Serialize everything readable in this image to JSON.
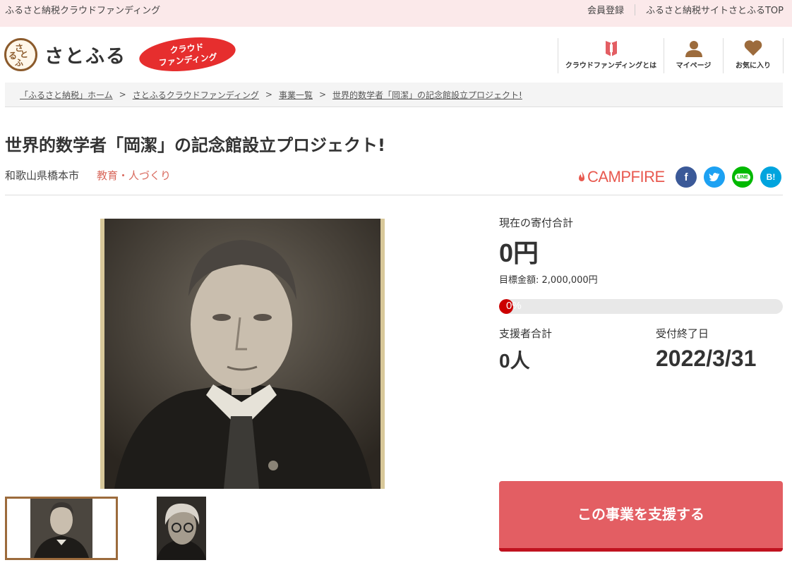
{
  "topbar": {
    "site_name": "ふるさと納税クラウドファンディング",
    "register": "会員登録",
    "site_top": "ふるさと納税サイトさとふるTOP"
  },
  "header": {
    "logo_text": "さとふる",
    "badge_line1": "クラウド",
    "badge_line2": "ファンディング",
    "nav": [
      {
        "label": "クラウドファンディングとは",
        "icon": "book-icon"
      },
      {
        "label": "マイページ",
        "icon": "user-icon"
      },
      {
        "label": "お気に入り",
        "icon": "heart-icon"
      }
    ]
  },
  "breadcrumb": [
    "「ふるさと納税」ホーム",
    "さとふるクラウドファンディング",
    "事業一覧",
    "世界的数学者「岡潔」の記念館設立プロジェクト!"
  ],
  "breadcrumb_sep": ">",
  "project": {
    "title": "世界的数学者「岡潔」の記念館設立プロジェクト!",
    "location": "和歌山県橋本市",
    "category": "教育・人づくり",
    "partner": "CAMPFIRE"
  },
  "social": {
    "facebook": "f",
    "line": "LINE",
    "hatena": "B!"
  },
  "funding": {
    "current_label": "現在の寄付合計",
    "current_amount": "0円",
    "target": "目標金額: 2,000,000円",
    "progress_pct": "0%",
    "supporters_label": "支援者合計",
    "supporters": "0人",
    "deadline_label": "受付終了日",
    "deadline": "2022/3/31"
  },
  "cta": {
    "support_button": "この事業を支援する"
  },
  "colors": {
    "topbar_bg": "#fbe9ea",
    "accent_red": "#e35e63",
    "category": "#d96a5e",
    "brand_brown": "#8b5a2b"
  }
}
